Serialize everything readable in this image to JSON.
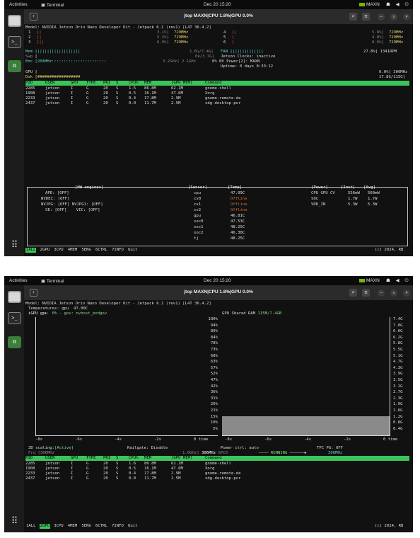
{
  "desktop": {
    "activities": "Activities",
    "terminal_app": "Terminal",
    "clock": "Dec 20  15:20",
    "maxn": "MAXN",
    "tray_icons": "☗ ◀ ⏻"
  },
  "window": {
    "title": "jtop MAXN|CPU 1.8%|GPU 0.0%",
    "new_tab": "+",
    "search": "⌕",
    "menu": "≡",
    "minimize": "–",
    "maximize": "▫",
    "close": "×"
  },
  "model_line": "Model: NVIDIA Jetson Orin Nano Developer Kit - Jetpack 6.1 (rev1) [L4T 36.4.2]",
  "screen1": {
    "cpus_left": [
      {
        "idx": "1",
        "bar": "[|",
        "pct": "3.1%]",
        "freq": "729MHz"
      },
      {
        "idx": "2",
        "bar": "[|",
        "pct": "5.2%]",
        "freq": "729MHz"
      },
      {
        "idx": "3",
        "bar": "[||",
        "pct": "6.9%]",
        "freq": "729MHz"
      }
    ],
    "cpus_right": [
      {
        "idx": "4",
        "bar": "[|",
        "pct": "5.8%]",
        "freq": "729MHz"
      },
      {
        "idx": "5",
        "bar": "[",
        "pct": "4.8%]",
        "freq": "729MHz"
      },
      {
        "idx": "6",
        "bar": "[",
        "pct": "8.6%]",
        "freq": "729MHz"
      }
    ],
    "mem_label": "Mem",
    "mem_bar": "[||||||||||||||||||",
    "mem_val": "1.6G/7.4G]",
    "fan_label": "FAN",
    "fan_bar": "[|||||||||||||",
    "fan_val": "27.8%] 1341RPM",
    "swp_label": "Swp",
    "swp_bar": "[",
    "swp_val": "0k/3.7G]",
    "jclk": "Jetson Clocks: inactive",
    "emc_label": "Emc",
    "emc_bar": "[204MHz:::::::::::::::::::::::",
    "emc_val": "3.2GHz] 2.1GHz",
    "nvp": "0% NV Power[2]: MAXN",
    "uptime": "Uptime: 0 days 0:33:12",
    "gpu_label": "GPU",
    "gpu_bar": "[",
    "gpu_val": "0.0%] 306MHz",
    "dsk_label": "Dsk",
    "dsk_bar": "[##################",
    "dsk_val": "17.8G/115G]",
    "hw_title": "[HW engines]",
    "hw": [
      "APE: [OFF]",
      "NVDEC: [OFF]",
      "NVJPG: [OFF] NVJPG1: [OFF]",
      "SE: [OFF]    VIC: [OFF]"
    ],
    "sensor_title": "[Sensor]",
    "temp_title": "[Temp]",
    "sensors": [
      {
        "n": "cpu",
        "t": "47.09C"
      },
      {
        "n": "cv0",
        "t": "Offline"
      },
      {
        "n": "cv1",
        "t": "Offline"
      },
      {
        "n": "cv2",
        "t": "Offline"
      },
      {
        "n": "gpu",
        "t": "46.81C"
      },
      {
        "n": "soc0",
        "t": "47.53C"
      },
      {
        "n": "soc1",
        "t": "48.25C"
      },
      {
        "n": "soc2",
        "t": "46.38C"
      },
      {
        "n": "tj",
        "t": "48.25C"
      }
    ],
    "power_title": "[Power]",
    "inst_title": "[Inst]",
    "avg_title": "[Avg]",
    "power": [
      {
        "n": "CPU GPU CV",
        "i": "556mW",
        "a": "560mW"
      },
      {
        "n": "SOC",
        "i": "1.7W",
        "a": "1.7W"
      },
      {
        "n": "VDD_IN",
        "i": "5.3W",
        "a": "5.3W"
      }
    ]
  },
  "screen2": {
    "temps": "Temperatures: gpu  47.00C",
    "igpu": "iGPU gpu",
    "igpu_stat": "0% - gov: nvhost_podgov",
    "shared_ram": "GPU Shared RAM",
    "shared_val": "115M/7.4GB",
    "time_axis": [
      "-8s",
      "-6s",
      "-4s",
      "-2s",
      "0 time"
    ],
    "time_axis_r": [
      "-8s",
      "-6s",
      "-4s",
      "-2s",
      "0 time"
    ],
    "left_ticks": [
      "100%",
      "94%",
      "89%",
      "84%",
      "78%",
      "73%",
      "68%",
      "63%",
      "57%",
      "52%",
      "47%",
      "42%",
      "36%",
      "31%",
      "26%",
      "21%",
      "15%",
      "10%",
      "5%"
    ],
    "right_ticks": [
      "7.4G",
      "7.0G",
      "6.6G",
      "6.2G",
      "5.8G",
      "5.5G",
      "5.1G",
      "4.7G",
      "4.3G",
      "3.9G",
      "3.5G",
      "3.1G",
      "2.7G",
      "2.3G",
      "1.9G",
      "1.6G",
      "1.2G",
      "0.8G",
      "0.4G"
    ],
    "scaling": "3D scaling:",
    "scaling_val": "[Active]",
    "railgate": "Railgate: Disable",
    "power_ctrl": "Power ctrl: auto",
    "tpc": "TPC PG: OFF",
    "frq": "Frq [306MHz",
    "frq_mid": "1.0GHz] 306MHz GPC0",
    "running": "RUNNING",
    "frq_right": "306MHz"
  },
  "table": {
    "headers": [
      "PID",
      "USER",
      "GPU",
      "TYPE",
      "PRI",
      "S",
      "CPU%",
      "MEM",
      "[GPU MEM]",
      "Command"
    ],
    "rows": [
      [
        "2285",
        "jetson",
        "I",
        "G",
        "20",
        "S",
        "1.5",
        "86.8M",
        "62.1M",
        "gnome-shell"
      ],
      [
        "1908",
        "jetson",
        "I",
        "G",
        "20",
        "S",
        "0.5",
        "16.1M",
        "47.6M",
        "Xorg"
      ],
      [
        "2233",
        "jetson",
        "I",
        "G",
        "20",
        "S",
        "0.4",
        "17.8M",
        "2.9M",
        "gnome-remote-de"
      ],
      [
        "2437",
        "jetson",
        "I",
        "G",
        "20",
        "S",
        "0.0",
        "11.7M",
        "2.5M",
        "xdg-desktop-por"
      ]
    ],
    "rows2": [
      [
        "2285",
        "jetson",
        "I",
        "G",
        "20",
        "S",
        "1.6",
        "86.8M",
        "62.1M",
        "gnome-shell"
      ],
      [
        "1908",
        "jetson",
        "I",
        "G",
        "20",
        "S",
        "0.5",
        "16.1M",
        "47.6M",
        "Xorg"
      ],
      [
        "2233",
        "jetson",
        "I",
        "G",
        "20",
        "S",
        "0.4",
        "17.8M",
        "2.9M",
        "gnome-remote-de"
      ],
      [
        "2437",
        "jetson",
        "I",
        "G",
        "20",
        "S",
        "0.0",
        "11.7M",
        "2.5M",
        "xdg-desktop-por"
      ]
    ]
  },
  "tabs": [
    {
      "n": "1",
      "l": "ALL"
    },
    {
      "n": "2",
      "l": "GPU"
    },
    {
      "n": "3",
      "l": "CPU"
    },
    {
      "n": "4",
      "l": "MEM"
    },
    {
      "n": "5",
      "l": "ENG"
    },
    {
      "n": "6",
      "l": "CTRL"
    },
    {
      "n": "7",
      "l": "INFO"
    },
    {
      "n": "",
      "l": "Quit"
    }
  ],
  "copyright": "(c) 2024, RB",
  "gpu_ram_fraction": 0.16
}
